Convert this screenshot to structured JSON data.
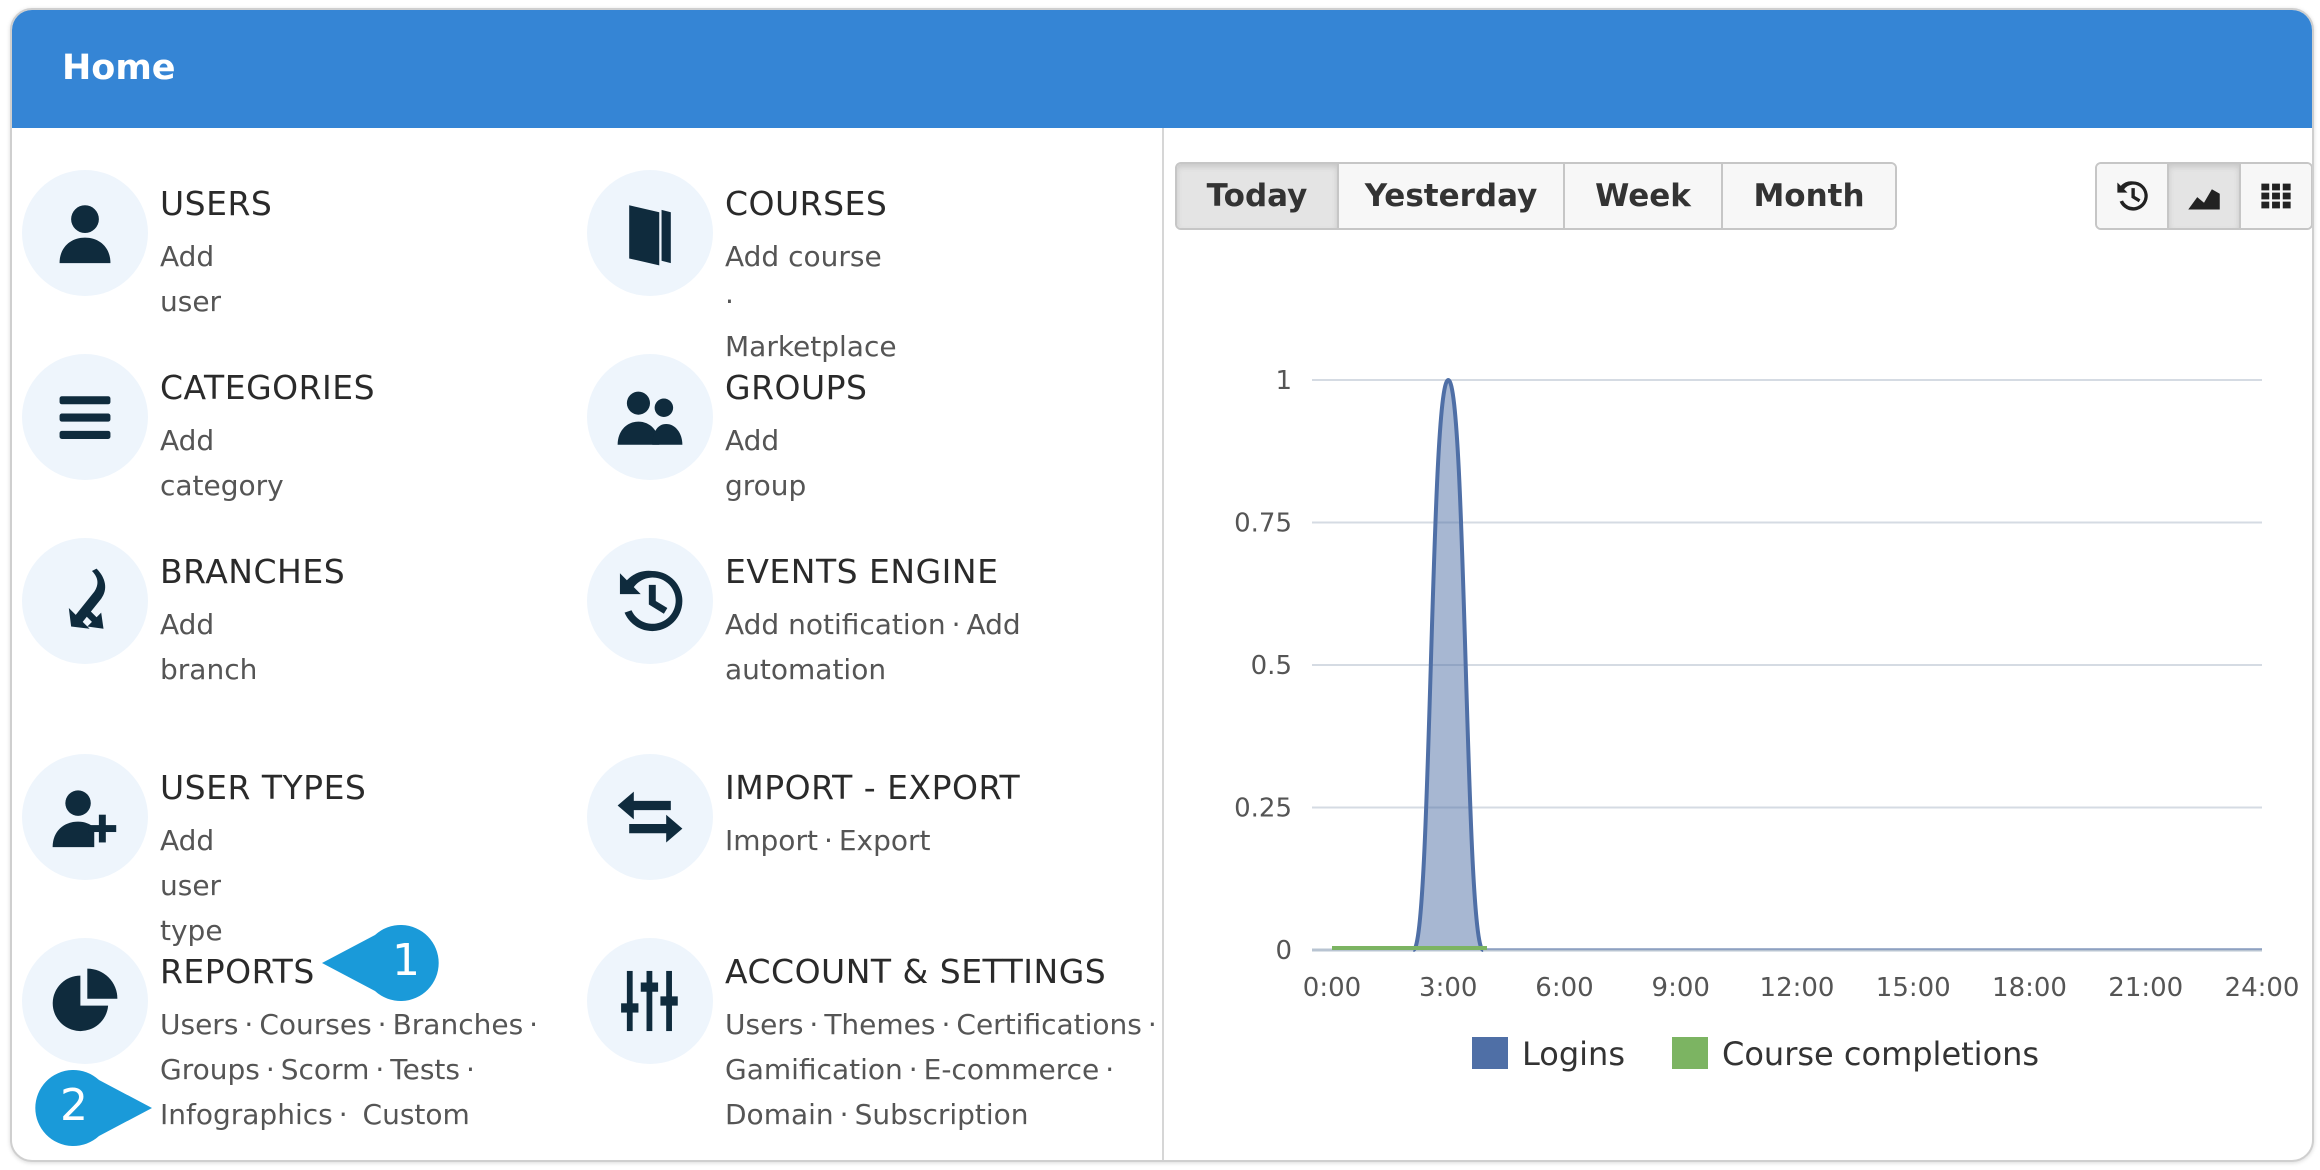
{
  "header": {
    "title": "Home"
  },
  "tiles": [
    {
      "title": "USERS",
      "links": [
        "Add user"
      ],
      "icon": "user-icon"
    },
    {
      "title": "COURSES",
      "links": [
        "Add course",
        "Marketplace"
      ],
      "icon": "book-icon"
    },
    {
      "title": "CATEGORIES",
      "links": [
        "Add category"
      ],
      "icon": "list-icon"
    },
    {
      "title": "GROUPS",
      "links": [
        "Add group"
      ],
      "icon": "group-icon"
    },
    {
      "title": "BRANCHES",
      "links": [
        "Add branch"
      ],
      "icon": "branch-icon"
    },
    {
      "title": "EVENTS ENGINE",
      "links": [
        "Add notification",
        "Add automation"
      ],
      "icon": "history-icon"
    },
    {
      "title": "USER TYPES",
      "links": [
        "Add user type"
      ],
      "icon": "user-plus-icon"
    },
    {
      "title": "IMPORT - EXPORT",
      "links": [
        "Import",
        "Export"
      ],
      "icon": "exchange-icon"
    },
    {
      "title": "REPORTS",
      "links": [
        "Users",
        "Courses",
        "Branches",
        "Groups",
        "Scorm",
        "Tests",
        "Infographics",
        "Custom"
      ],
      "icon": "pie-chart-icon"
    },
    {
      "title": "ACCOUNT & SETTINGS",
      "links": [
        "Users",
        "Themes",
        "Certifications",
        "Gamification",
        "E-commerce",
        "Domain",
        "Subscription"
      ],
      "icon": "sliders-icon"
    }
  ],
  "callouts": [
    "1",
    "2"
  ],
  "range_tabs": [
    "Today",
    "Yesterday",
    "Week",
    "Month"
  ],
  "active_range": "Today",
  "view_buttons": [
    {
      "name": "history-view",
      "icon": "history-icon"
    },
    {
      "name": "area-chart-view",
      "icon": "area-chart-icon",
      "active": true
    },
    {
      "name": "grid-view",
      "icon": "grid-icon"
    }
  ],
  "colors": {
    "header": "#3585d5",
    "logins": "#4f6fa6",
    "completions": "#7cb462"
  },
  "chart_data": {
    "type": "area",
    "title": "",
    "xlabel": "",
    "ylabel": "",
    "x": [
      "0:00",
      "3:00",
      "6:00",
      "9:00",
      "12:00",
      "15:00",
      "18:00",
      "21:00",
      "24:00"
    ],
    "x_ticks": [
      "0:00",
      "3:00",
      "6:00",
      "9:00",
      "12:00",
      "15:00",
      "18:00",
      "21:00",
      "24:00"
    ],
    "y_ticks": [
      "0",
      "0.25",
      "0.5",
      "0.75",
      "1"
    ],
    "ylim": [
      0,
      1
    ],
    "xlim": [
      0,
      24
    ],
    "grid": true,
    "legend_position": "bottom",
    "series": [
      {
        "name": "Logins",
        "color": "#4f6fa6",
        "points": [
          [
            0,
            0
          ],
          [
            1,
            0
          ],
          [
            2,
            0
          ],
          [
            3,
            1
          ],
          [
            4,
            0
          ],
          [
            5,
            0
          ],
          [
            6,
            0
          ],
          [
            9,
            0
          ],
          [
            12,
            0
          ],
          [
            15,
            0
          ],
          [
            18,
            0
          ],
          [
            21,
            0
          ],
          [
            24,
            0
          ]
        ]
      },
      {
        "name": "Course completions",
        "color": "#7cb462",
        "points": [
          [
            0,
            0
          ],
          [
            1,
            0
          ],
          [
            2,
            0
          ],
          [
            3,
            0
          ],
          [
            4,
            0
          ]
        ]
      }
    ]
  }
}
